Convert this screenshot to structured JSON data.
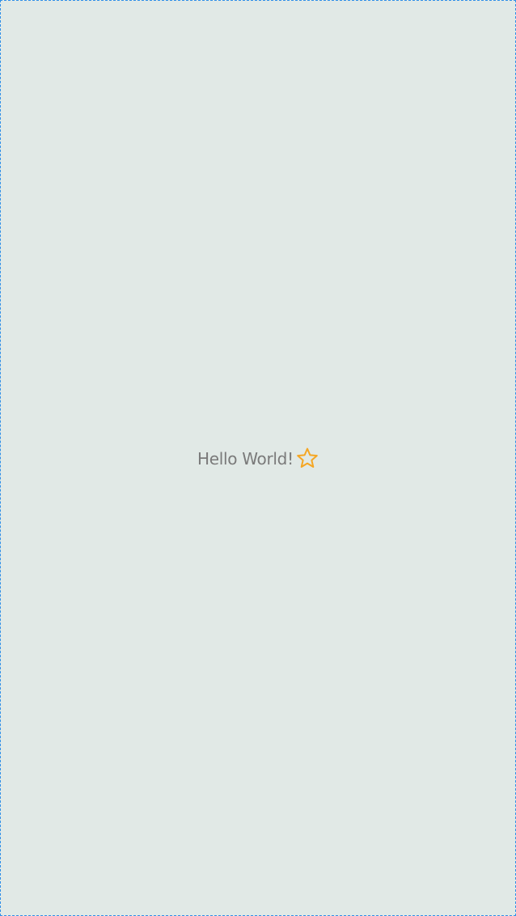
{
  "greeting": {
    "text": "Hello World!",
    "icon": "star-outline-icon"
  },
  "colors": {
    "background": "#e1e9e6",
    "border": "#2f8fe8",
    "text": "#7a7a7a",
    "star": "#f5a623"
  }
}
